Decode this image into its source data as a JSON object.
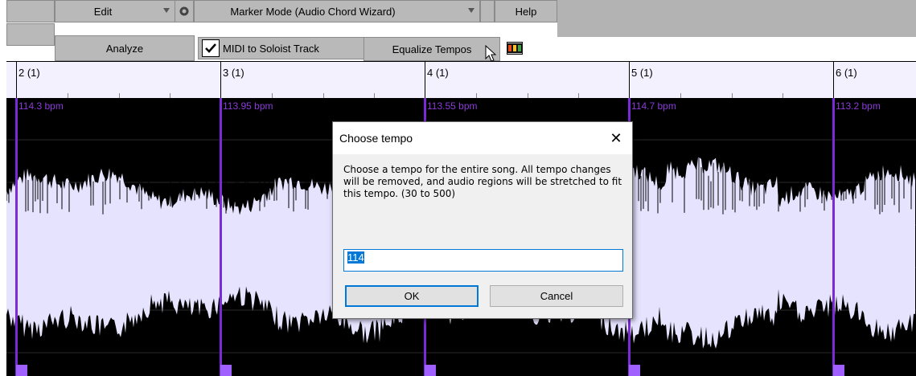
{
  "toolbar": {
    "edit_label": "Edit",
    "marker_mode_label": "Marker Mode (Audio Chord Wizard)",
    "help_label": "Help",
    "analyze_label": "Analyze",
    "midi_to_soloist_label": "MIDI to Soloist Track",
    "midi_to_soloist_checked": true,
    "equalize_tempos_label": "Equalize Tempos"
  },
  "ruler": {
    "bars": [
      "2 (1)",
      "3 (1)",
      "4 (1)",
      "5 (1)",
      "6 (1)"
    ]
  },
  "track": {
    "tempos": [
      "114.3 bpm",
      "113.95 bpm",
      "113.55 bpm",
      "114.7 bpm",
      "113.2 bpm"
    ],
    "colors": {
      "background": "#000000",
      "waveform": "#e6e3ff",
      "marker": "#7a2ad6",
      "bpm_text": "#8a3bd9"
    }
  },
  "dialog": {
    "title": "Choose tempo",
    "message": "Choose a tempo for the entire song. All tempo changes will be removed, and audio regions will be stretched to fit this tempo. (30 to 500)",
    "input_value": "114",
    "ok_label": "OK",
    "cancel_label": "Cancel"
  }
}
